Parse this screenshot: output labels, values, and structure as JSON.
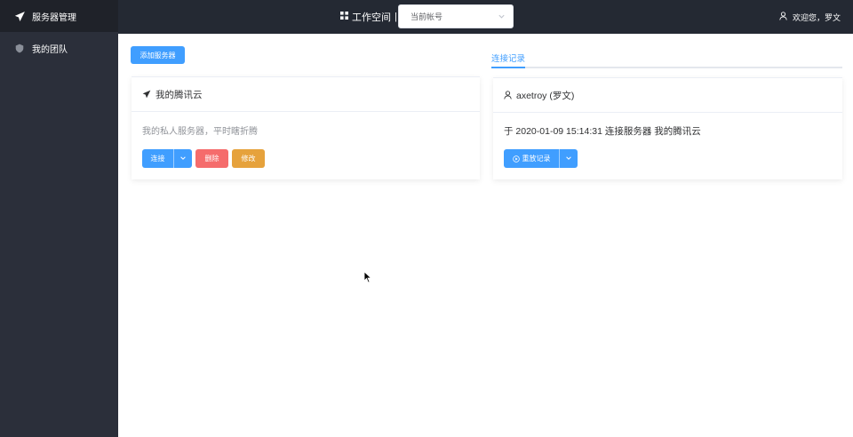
{
  "sidebar": {
    "items": [
      {
        "label": "服务器管理",
        "icon": "send-icon",
        "active": true
      },
      {
        "label": "我的团队",
        "icon": "shield-icon",
        "active": false
      }
    ]
  },
  "header": {
    "workspace_label": "工作空间",
    "separator": "|",
    "account_select_value": "当前帐号",
    "welcome_text": "欢迎您，罗文"
  },
  "toolbar": {
    "add_server_label": "添加服务器"
  },
  "server_card": {
    "title": "我的腾讯云",
    "description": "我的私人服务器，平时瞎折腾",
    "connect_label": "连接",
    "delete_label": "删除",
    "edit_label": "修改"
  },
  "tabs": [
    {
      "label": "连接记录",
      "active": true
    }
  ],
  "log_card": {
    "user": "axetroy (罗文)",
    "entry": "于 2020-01-09 15:14:31 连接服务器 我的腾讯云",
    "replay_label": "重放记录"
  },
  "colors": {
    "sidebar_bg": "#2b2f3a",
    "header_bg": "#242933",
    "primary": "#409eff",
    "danger": "#f56c6c",
    "warning": "#e6a23c"
  }
}
